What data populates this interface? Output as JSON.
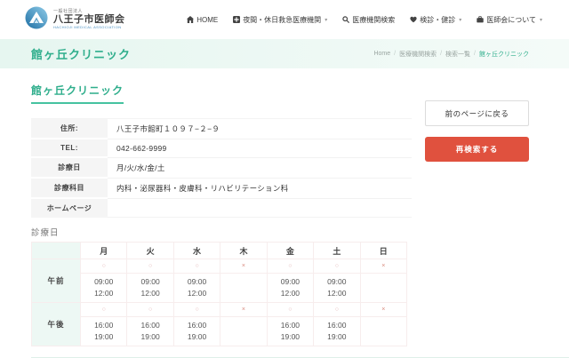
{
  "colors": {
    "accent": "#2fae8c",
    "accent_underline": "#45c2a0",
    "button_red": "#e0513e",
    "mark_open": "#e3b7b7",
    "mark_closed": "#d98a7d",
    "banner_from": "#e6f6f0",
    "banner_to": "#f4fbf8"
  },
  "header": {
    "logo": {
      "org_type": "一般社団法人",
      "name": "八王子市医師会",
      "name_en": "HACHIOJI MEDICAL ASSOCIATION"
    },
    "nav": [
      {
        "id": "home",
        "label": "HOME",
        "icon": "home-icon",
        "dropdown": false
      },
      {
        "id": "emergency",
        "label": "夜間・休日救急医療機関",
        "icon": "plus-box-icon",
        "dropdown": true
      },
      {
        "id": "search",
        "label": "医療機関検索",
        "icon": "search-icon",
        "dropdown": false
      },
      {
        "id": "checkup",
        "label": "検診・健診",
        "icon": "heart-icon",
        "dropdown": true
      },
      {
        "id": "about",
        "label": "医師会について",
        "icon": "briefcase-icon",
        "dropdown": true
      }
    ]
  },
  "banner": {
    "title": "館ヶ丘クリニック",
    "breadcrumb": [
      "Home",
      "医療機関検索",
      "検索一覧",
      "館ヶ丘クリニック"
    ]
  },
  "clinic": {
    "name": "館ヶ丘クリニック",
    "info": [
      {
        "label": "住所:",
        "value": "八王子市館町１０９７−２−９"
      },
      {
        "label": "TEL:",
        "value": "042-662-9999"
      },
      {
        "label": "診療日",
        "value": "月/火/水/金/土"
      },
      {
        "label": "診療科目",
        "value": "内科・泌尿器科・皮膚科・リハビリテーション科"
      },
      {
        "label": "ホームページ",
        "value": ""
      }
    ]
  },
  "actions": {
    "back_label": "前のページに戻る",
    "research_label": "再検索する"
  },
  "schedule": {
    "heading": "診療日",
    "days": [
      "月",
      "火",
      "水",
      "木",
      "金",
      "土",
      "日"
    ],
    "open_mark": "○",
    "closed_mark": "×",
    "sessions": [
      {
        "label": "午前",
        "marks": [
          "○",
          "○",
          "○",
          "×",
          "○",
          "○",
          "×"
        ],
        "times": [
          [
            "09:00",
            "12:00"
          ],
          [
            "09:00",
            "12:00"
          ],
          [
            "09:00",
            "12:00"
          ],
          null,
          [
            "09:00",
            "12:00"
          ],
          [
            "09:00",
            "12:00"
          ],
          null
        ]
      },
      {
        "label": "午後",
        "marks": [
          "○",
          "○",
          "○",
          "×",
          "○",
          "○",
          "×"
        ],
        "times": [
          [
            "16:00",
            "19:00"
          ],
          [
            "16:00",
            "19:00"
          ],
          [
            "16:00",
            "19:00"
          ],
          null,
          [
            "16:00",
            "19:00"
          ],
          [
            "16:00",
            "19:00"
          ],
          null
        ]
      }
    ]
  }
}
